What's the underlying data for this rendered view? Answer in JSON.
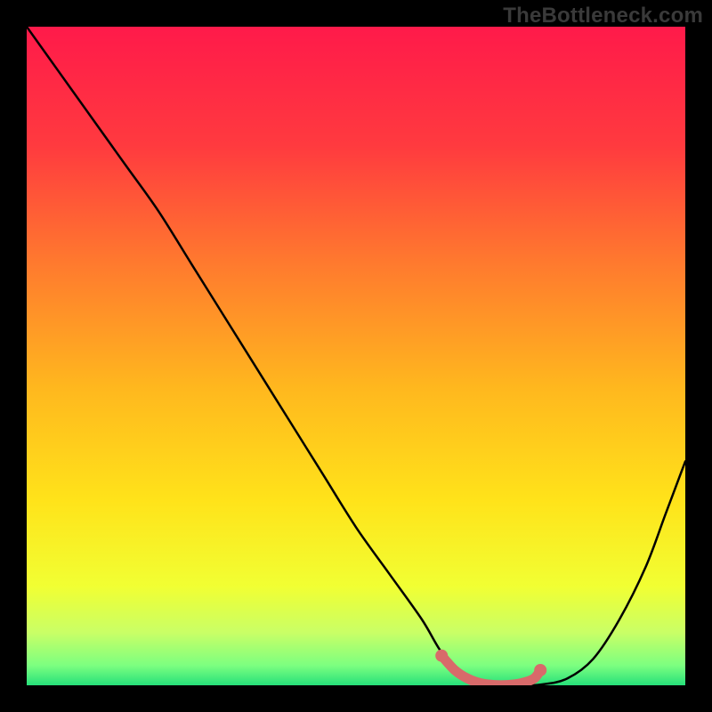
{
  "attribution": "TheBottleneck.com",
  "chart_data": {
    "type": "line",
    "title": "",
    "xlabel": "",
    "ylabel": "",
    "xlim": [
      0,
      100
    ],
    "ylim": [
      0,
      100
    ],
    "x": [
      0,
      5,
      10,
      15,
      20,
      25,
      30,
      35,
      40,
      45,
      50,
      55,
      60,
      63,
      66,
      69,
      72,
      75,
      78,
      82,
      86,
      90,
      94,
      97,
      100
    ],
    "values": [
      100,
      93,
      86,
      79,
      72,
      64,
      56,
      48,
      40,
      32,
      24,
      17,
      10,
      5,
      2,
      0.6,
      0.1,
      0,
      0.1,
      1,
      4,
      10,
      18,
      26,
      34
    ],
    "highlight_segment": {
      "x": [
        63,
        65,
        67,
        69,
        71,
        73,
        75,
        77,
        78
      ],
      "values": [
        4.5,
        2.3,
        1.0,
        0.3,
        0.05,
        0.05,
        0.3,
        1.0,
        2.3
      ]
    },
    "background_gradient": {
      "stops": [
        {
          "offset": 0.0,
          "color": "#ff1a4a"
        },
        {
          "offset": 0.18,
          "color": "#ff3a3f"
        },
        {
          "offset": 0.36,
          "color": "#ff7a2e"
        },
        {
          "offset": 0.55,
          "color": "#ffb81e"
        },
        {
          "offset": 0.72,
          "color": "#ffe31a"
        },
        {
          "offset": 0.85,
          "color": "#f1ff33"
        },
        {
          "offset": 0.92,
          "color": "#c9ff66"
        },
        {
          "offset": 0.97,
          "color": "#7cff80"
        },
        {
          "offset": 1.0,
          "color": "#26e07a"
        }
      ]
    },
    "colors": {
      "line": "#000000",
      "highlight": "#d86a6a"
    }
  }
}
